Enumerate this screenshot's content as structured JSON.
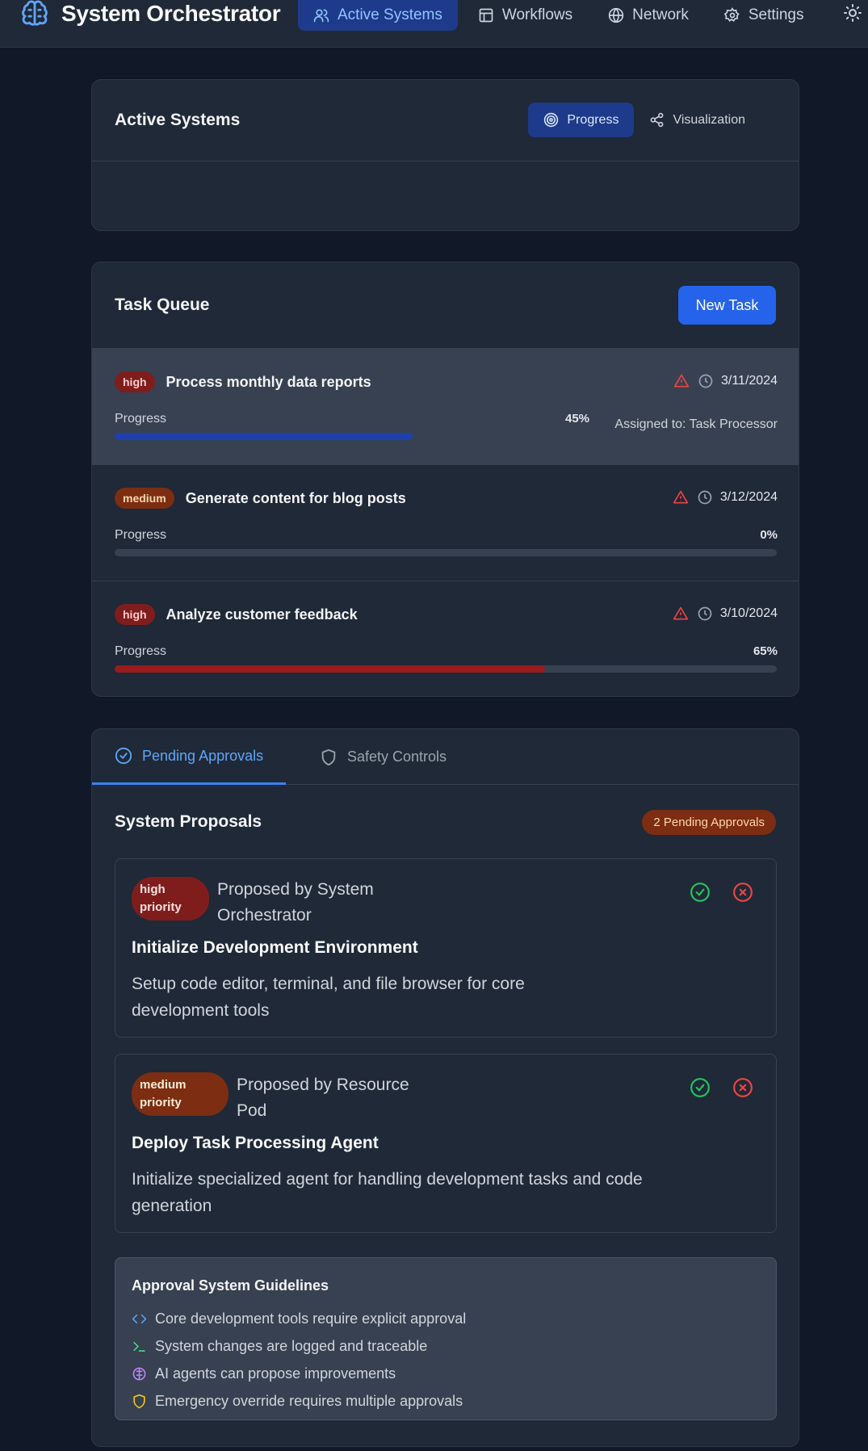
{
  "app": {
    "title": "System Orchestrator",
    "icon": "brain-icon",
    "accent": "#60a5fa"
  },
  "nav": {
    "items": [
      {
        "label": "Active Systems",
        "icon": "users-icon",
        "active": true
      },
      {
        "label": "Workflows",
        "icon": "layout-icon",
        "active": false
      },
      {
        "label": "Network",
        "icon": "globe-icon",
        "active": false
      },
      {
        "label": "Settings",
        "icon": "gear-icon",
        "active": false
      }
    ],
    "theme_icon": "sun-icon"
  },
  "active_systems": {
    "title": "Active Systems",
    "views": [
      {
        "label": "Progress",
        "icon": "target-icon",
        "active": true
      },
      {
        "label": "Visualization",
        "icon": "share-icon",
        "active": false
      }
    ]
  },
  "task_queue": {
    "title": "Task Queue",
    "new_task_label": "New Task",
    "progress_label": "Progress",
    "tasks": [
      {
        "priority": "high",
        "title": "Process monthly data reports",
        "date": "3/11/2024",
        "progress": 45,
        "progress_text": "45%",
        "assigned": "Assigned to: Task Processor",
        "bar_color": "#1e40af"
      },
      {
        "priority": "medium",
        "title": "Generate content for blog posts",
        "date": "3/12/2024",
        "progress": 0,
        "progress_text": "0%",
        "assigned": "",
        "bar_color": "#1e40af"
      },
      {
        "priority": "high",
        "title": "Analyze customer feedback",
        "date": "3/10/2024",
        "progress": 65,
        "progress_text": "65%",
        "assigned": "",
        "bar_color": "#991b1b"
      }
    ]
  },
  "approvals": {
    "tabs": [
      {
        "label": "Pending Approvals",
        "icon": "check-circle-icon",
        "active": true
      },
      {
        "label": "Safety Controls",
        "icon": "shield-icon",
        "active": false
      }
    ],
    "proposals_title": "System Proposals",
    "pending_badge": "2 Pending Approvals",
    "proposals": [
      {
        "priority": "high priority",
        "by": "Proposed by System Orchestrator",
        "title": "Initialize Development Environment",
        "description": "Setup code editor, terminal, and file browser for core development tools"
      },
      {
        "priority": "medium priority",
        "by": "Proposed by Resource Pod",
        "title": "Deploy Task Processing Agent",
        "description": "Initialize specialized agent for handling development tasks and code generation"
      }
    ],
    "guidelines": {
      "title": "Approval System Guidelines",
      "items": [
        {
          "text": "Core development tools require explicit approval",
          "icon": "code-icon"
        },
        {
          "text": "System changes are logged and traceable",
          "icon": "terminal-icon"
        },
        {
          "text": "AI agents can propose improvements",
          "icon": "brain-icon"
        },
        {
          "text": "Emergency override requires multiple approvals",
          "icon": "shield-icon"
        }
      ]
    }
  },
  "colors": {
    "background": "#111827",
    "card": "#1f2937",
    "primary": "#2563eb",
    "high": "#7f1d1d",
    "medium": "#7c2d12",
    "approve": "#22c55e",
    "reject": "#ef4444",
    "warning": "#ef4444"
  }
}
